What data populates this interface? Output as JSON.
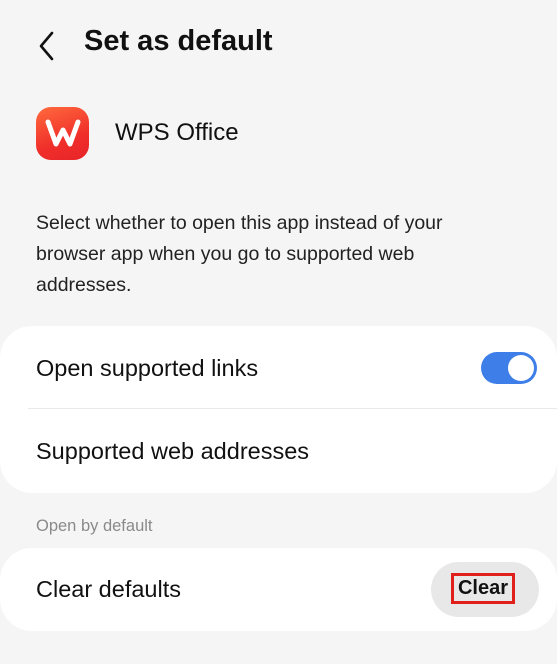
{
  "header": {
    "title": "Set as default",
    "back_icon": "chevron-left-icon"
  },
  "app": {
    "name": "WPS Office",
    "icon": "wps-office-logo-icon",
    "icon_color": "#f0302b"
  },
  "description": "Select whether to open this app instead of your browser app when you go to supported web addresses.",
  "links_section": {
    "open_supported_links": {
      "label": "Open supported links",
      "enabled": true,
      "toggle_color": "#3e7ee8"
    },
    "supported_web_addresses": {
      "label": "Supported web addresses"
    }
  },
  "open_by_default": {
    "section_label": "Open by default",
    "clear_defaults": {
      "label": "Clear defaults",
      "button_label": "Clear",
      "highlight_color": "#e0201b"
    }
  }
}
